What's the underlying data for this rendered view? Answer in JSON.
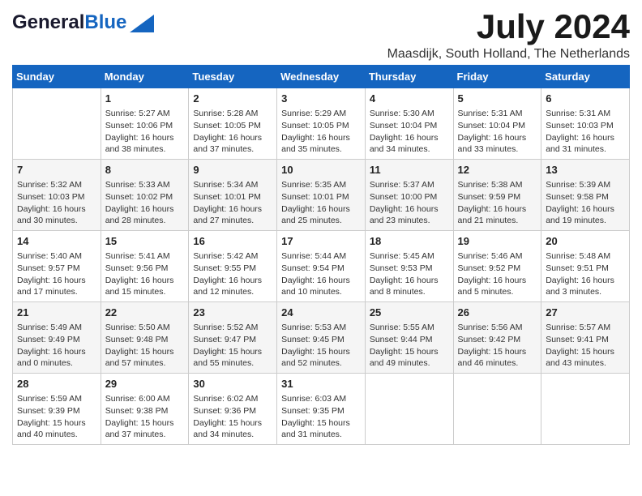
{
  "header": {
    "logo_line1": "General",
    "logo_line2": "Blue",
    "month": "July 2024",
    "location": "Maasdijk, South Holland, The Netherlands"
  },
  "days_of_week": [
    "Sunday",
    "Monday",
    "Tuesday",
    "Wednesday",
    "Thursday",
    "Friday",
    "Saturday"
  ],
  "weeks": [
    [
      {
        "day": "",
        "info": ""
      },
      {
        "day": "1",
        "info": "Sunrise: 5:27 AM\nSunset: 10:06 PM\nDaylight: 16 hours\nand 38 minutes."
      },
      {
        "day": "2",
        "info": "Sunrise: 5:28 AM\nSunset: 10:05 PM\nDaylight: 16 hours\nand 37 minutes."
      },
      {
        "day": "3",
        "info": "Sunrise: 5:29 AM\nSunset: 10:05 PM\nDaylight: 16 hours\nand 35 minutes."
      },
      {
        "day": "4",
        "info": "Sunrise: 5:30 AM\nSunset: 10:04 PM\nDaylight: 16 hours\nand 34 minutes."
      },
      {
        "day": "5",
        "info": "Sunrise: 5:31 AM\nSunset: 10:04 PM\nDaylight: 16 hours\nand 33 minutes."
      },
      {
        "day": "6",
        "info": "Sunrise: 5:31 AM\nSunset: 10:03 PM\nDaylight: 16 hours\nand 31 minutes."
      }
    ],
    [
      {
        "day": "7",
        "info": "Sunrise: 5:32 AM\nSunset: 10:03 PM\nDaylight: 16 hours\nand 30 minutes."
      },
      {
        "day": "8",
        "info": "Sunrise: 5:33 AM\nSunset: 10:02 PM\nDaylight: 16 hours\nand 28 minutes."
      },
      {
        "day": "9",
        "info": "Sunrise: 5:34 AM\nSunset: 10:01 PM\nDaylight: 16 hours\nand 27 minutes."
      },
      {
        "day": "10",
        "info": "Sunrise: 5:35 AM\nSunset: 10:01 PM\nDaylight: 16 hours\nand 25 minutes."
      },
      {
        "day": "11",
        "info": "Sunrise: 5:37 AM\nSunset: 10:00 PM\nDaylight: 16 hours\nand 23 minutes."
      },
      {
        "day": "12",
        "info": "Sunrise: 5:38 AM\nSunset: 9:59 PM\nDaylight: 16 hours\nand 21 minutes."
      },
      {
        "day": "13",
        "info": "Sunrise: 5:39 AM\nSunset: 9:58 PM\nDaylight: 16 hours\nand 19 minutes."
      }
    ],
    [
      {
        "day": "14",
        "info": "Sunrise: 5:40 AM\nSunset: 9:57 PM\nDaylight: 16 hours\nand 17 minutes."
      },
      {
        "day": "15",
        "info": "Sunrise: 5:41 AM\nSunset: 9:56 PM\nDaylight: 16 hours\nand 15 minutes."
      },
      {
        "day": "16",
        "info": "Sunrise: 5:42 AM\nSunset: 9:55 PM\nDaylight: 16 hours\nand 12 minutes."
      },
      {
        "day": "17",
        "info": "Sunrise: 5:44 AM\nSunset: 9:54 PM\nDaylight: 16 hours\nand 10 minutes."
      },
      {
        "day": "18",
        "info": "Sunrise: 5:45 AM\nSunset: 9:53 PM\nDaylight: 16 hours\nand 8 minutes."
      },
      {
        "day": "19",
        "info": "Sunrise: 5:46 AM\nSunset: 9:52 PM\nDaylight: 16 hours\nand 5 minutes."
      },
      {
        "day": "20",
        "info": "Sunrise: 5:48 AM\nSunset: 9:51 PM\nDaylight: 16 hours\nand 3 minutes."
      }
    ],
    [
      {
        "day": "21",
        "info": "Sunrise: 5:49 AM\nSunset: 9:49 PM\nDaylight: 16 hours\nand 0 minutes."
      },
      {
        "day": "22",
        "info": "Sunrise: 5:50 AM\nSunset: 9:48 PM\nDaylight: 15 hours\nand 57 minutes."
      },
      {
        "day": "23",
        "info": "Sunrise: 5:52 AM\nSunset: 9:47 PM\nDaylight: 15 hours\nand 55 minutes."
      },
      {
        "day": "24",
        "info": "Sunrise: 5:53 AM\nSunset: 9:45 PM\nDaylight: 15 hours\nand 52 minutes."
      },
      {
        "day": "25",
        "info": "Sunrise: 5:55 AM\nSunset: 9:44 PM\nDaylight: 15 hours\nand 49 minutes."
      },
      {
        "day": "26",
        "info": "Sunrise: 5:56 AM\nSunset: 9:42 PM\nDaylight: 15 hours\nand 46 minutes."
      },
      {
        "day": "27",
        "info": "Sunrise: 5:57 AM\nSunset: 9:41 PM\nDaylight: 15 hours\nand 43 minutes."
      }
    ],
    [
      {
        "day": "28",
        "info": "Sunrise: 5:59 AM\nSunset: 9:39 PM\nDaylight: 15 hours\nand 40 minutes."
      },
      {
        "day": "29",
        "info": "Sunrise: 6:00 AM\nSunset: 9:38 PM\nDaylight: 15 hours\nand 37 minutes."
      },
      {
        "day": "30",
        "info": "Sunrise: 6:02 AM\nSunset: 9:36 PM\nDaylight: 15 hours\nand 34 minutes."
      },
      {
        "day": "31",
        "info": "Sunrise: 6:03 AM\nSunset: 9:35 PM\nDaylight: 15 hours\nand 31 minutes."
      },
      {
        "day": "",
        "info": ""
      },
      {
        "day": "",
        "info": ""
      },
      {
        "day": "",
        "info": ""
      }
    ]
  ]
}
